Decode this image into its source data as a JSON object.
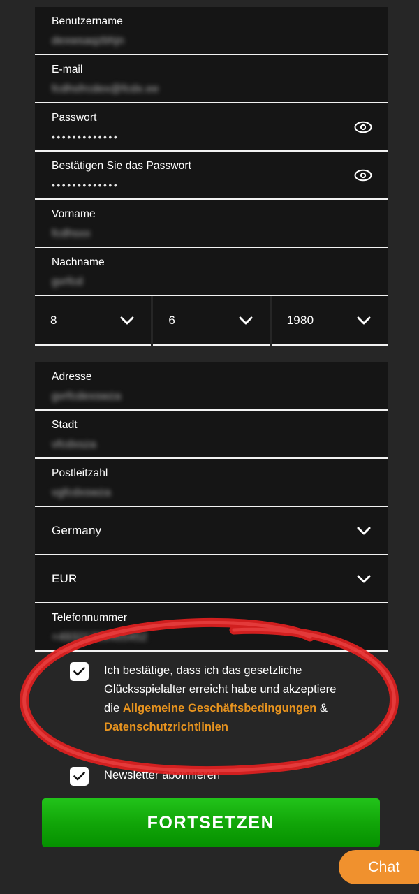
{
  "form": {
    "fields": [
      {
        "name": "username",
        "label": "Benutzername",
        "value": "dexwsaqzbhjn",
        "blurred": true,
        "type": "text"
      },
      {
        "name": "email",
        "label": "E-mail",
        "value": "fcdhsfrcdex@fcdx.ee",
        "blurred": true,
        "type": "text"
      },
      {
        "name": "password",
        "label": "Passwort",
        "value": "•••••••••••••",
        "blurred": false,
        "type": "password"
      },
      {
        "name": "confirm",
        "label": "Bestätigen Sie das Passwort",
        "value": "•••••••••••••",
        "blurred": false,
        "type": "password"
      },
      {
        "name": "firstname",
        "label": "Vorname",
        "value": "fcdhsxx",
        "blurred": true,
        "type": "text"
      },
      {
        "name": "lastname",
        "label": "Nachname",
        "value": "gvrfcd",
        "blurred": true,
        "type": "text"
      }
    ],
    "birthdate": {
      "day": "8",
      "month": "6",
      "year": "1980"
    },
    "address_fields": [
      {
        "name": "address",
        "label": "Adresse",
        "value": "gvrfcdexswza",
        "blurred": true
      },
      {
        "name": "city",
        "label": "Stadt",
        "value": "vfcdxsza",
        "blurred": true
      },
      {
        "name": "postcode",
        "label": "Postleitzahl",
        "value": "vgfcdxswza",
        "blurred": true
      }
    ],
    "country": "Germany",
    "currency": "EUR",
    "phone": {
      "label": "Telefonnummer",
      "value": "+49321709465452"
    },
    "terms": {
      "text_part1": "Ich bestätige, dass ich das gesetzliche Glücksspielalter erreicht habe und akzeptiere die ",
      "link1": "Allgemeine Geschäftsbedingungen",
      "separator": " & ",
      "link2": "Datenschutzrichtlinien"
    },
    "newsletter_label": "Newsletter abonnieren",
    "submit_label": "FORTSETZEN"
  },
  "chat": {
    "label": "Chat"
  },
  "colors": {
    "page_background": "#262626",
    "field_background": "#151515",
    "underline": "#f2f2f2",
    "link_orange": "#e8941f",
    "button_green": "#11a508",
    "chat_orange": "#f0912e",
    "annotation_red": "#e02020"
  }
}
